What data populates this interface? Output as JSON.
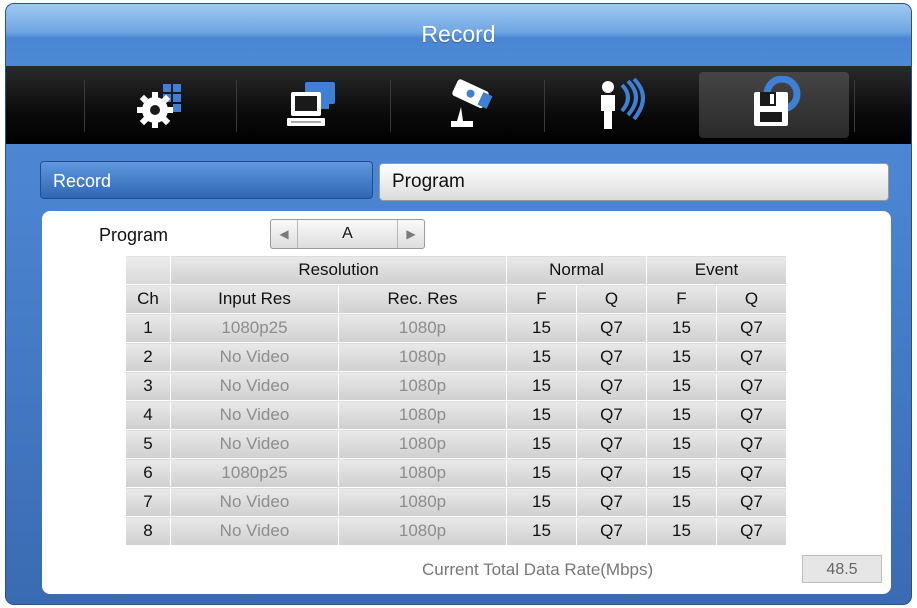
{
  "window": {
    "title": "Record"
  },
  "icon_tabs": [
    {
      "icon": "gear-icon",
      "active": false
    },
    {
      "icon": "network-computer-icon",
      "active": false
    },
    {
      "icon": "camera-icon",
      "active": false
    },
    {
      "icon": "event-sensor-icon",
      "active": false
    },
    {
      "icon": "floppy-disk-icon",
      "active": true
    }
  ],
  "subtabs": {
    "record": "Record",
    "program": "Program"
  },
  "program": {
    "label": "Program",
    "value": "A"
  },
  "table": {
    "group_headers": {
      "resolution": "Resolution",
      "normal": "Normal",
      "event": "Event"
    },
    "columns": [
      "Ch",
      "Input Res",
      "Rec. Res",
      "F",
      "Q",
      "F",
      "Q"
    ],
    "rows": [
      [
        "1",
        "1080p25",
        "1080p",
        "15",
        "Q7",
        "15",
        "Q7"
      ],
      [
        "2",
        "No Video",
        "1080p",
        "15",
        "Q7",
        "15",
        "Q7"
      ],
      [
        "3",
        "No Video",
        "1080p",
        "15",
        "Q7",
        "15",
        "Q7"
      ],
      [
        "4",
        "No Video",
        "1080p",
        "15",
        "Q7",
        "15",
        "Q7"
      ],
      [
        "5",
        "No Video",
        "1080p",
        "15",
        "Q7",
        "15",
        "Q7"
      ],
      [
        "6",
        "1080p25",
        "1080p",
        "15",
        "Q7",
        "15",
        "Q7"
      ],
      [
        "7",
        "No Video",
        "1080p",
        "15",
        "Q7",
        "15",
        "Q7"
      ],
      [
        "8",
        "No Video",
        "1080p",
        "15",
        "Q7",
        "15",
        "Q7"
      ]
    ]
  },
  "data_rate": {
    "label": "Current Total Data Rate(Mbps)",
    "value": "48.5"
  }
}
